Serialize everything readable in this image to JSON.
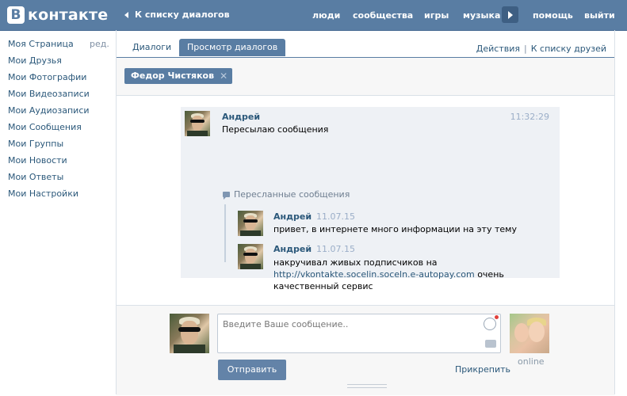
{
  "header": {
    "logo_letter": "В",
    "logo_text": "контакте",
    "back_label": "К списку диалогов",
    "nav": [
      "люди",
      "сообщества",
      "игры",
      "музыка",
      "помощь",
      "выйти"
    ]
  },
  "sidebar": {
    "items": [
      {
        "label": "Моя Страница",
        "extra": "ред."
      },
      {
        "label": "Мои Друзья"
      },
      {
        "label": "Мои Фотографии"
      },
      {
        "label": "Мои Видеозаписи"
      },
      {
        "label": "Мои Аудиозаписи"
      },
      {
        "label": "Мои Сообщения"
      },
      {
        "label": "Мои Группы"
      },
      {
        "label": "Мои Новости"
      },
      {
        "label": "Мои Ответы"
      },
      {
        "label": "Мои Настройки"
      }
    ]
  },
  "tabs": {
    "items": [
      "Диалоги",
      "Просмотр диалогов"
    ],
    "right_actions": [
      "Действия",
      "К списку друзей"
    ]
  },
  "filter": {
    "chip": "Федор Чистяков",
    "chip_close": "✕"
  },
  "message": {
    "author": "Андрей",
    "time": "11:32:29",
    "text": "Пересылаю сообщения",
    "forwarded_label": "Пересланные сообщения",
    "forwarded": [
      {
        "author": "Андрей",
        "date": "11.07.15",
        "text": "привет, в интернете много информации на эту тему"
      },
      {
        "author": "Андрей",
        "date": "11.07.15",
        "text_line1": "накручивал живых подписчиков на",
        "link": "http://vkontakte.socelin.soceln.e-autopay.com",
        "text_after_link": " очень",
        "text_line3": "качественный сервис"
      }
    ]
  },
  "compose": {
    "placeholder": "Введите Ваше сообщение..",
    "send_label": "Отправить",
    "attach_label": "Прикрепить",
    "peer_status": "online"
  },
  "colors": {
    "header": "#597da3",
    "link": "#2b587a",
    "message_bg": "#eef1f5"
  }
}
